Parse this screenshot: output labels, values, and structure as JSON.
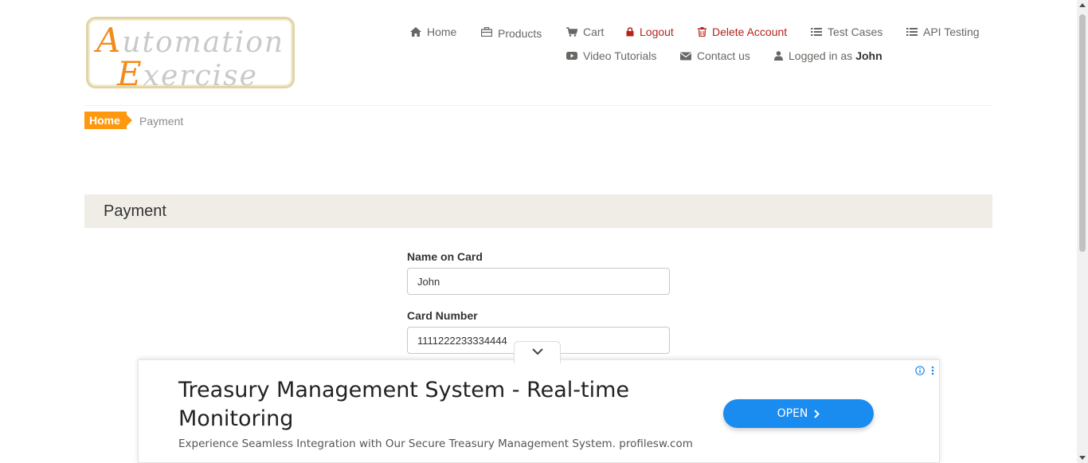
{
  "logo": {
    "line1_cap": "A",
    "line1_rest": "utomation",
    "line2_cap": "E",
    "line2_rest": "xercise"
  },
  "nav": {
    "home": "Home",
    "products": "Products",
    "cart": "Cart",
    "logout": "Logout",
    "delete_account": "Delete Account",
    "test_cases": "Test Cases",
    "api_testing": "API Testing",
    "video_tutorials": "Video Tutorials",
    "contact_us": "Contact us",
    "logged_in_prefix": "Logged in as",
    "logged_in_user": "John"
  },
  "breadcrumb": {
    "home": "Home",
    "current": "Payment"
  },
  "payment": {
    "title": "Payment",
    "name_label": "Name on Card",
    "name_value": "John",
    "card_label": "Card Number",
    "card_value": "1111222233334444"
  },
  "ad": {
    "title": "Treasury Management System - Real-time Monitoring",
    "description": "Experience Seamless Integration with Our Secure Treasury Management System. profilesw.com",
    "button": "OPEN"
  },
  "colors": {
    "accent": "#fe980f",
    "danger": "#b4241b",
    "ad_button": "#1a8cf0",
    "band": "#efede6"
  },
  "icons": [
    "home-icon",
    "products-icon",
    "cart-icon",
    "lock-icon",
    "trash-icon",
    "list-icon",
    "list-icon",
    "video-icon",
    "envelope-icon",
    "user-icon",
    "chevron-down-icon",
    "info-icon",
    "more-icon",
    "chevron-right-icon"
  ]
}
